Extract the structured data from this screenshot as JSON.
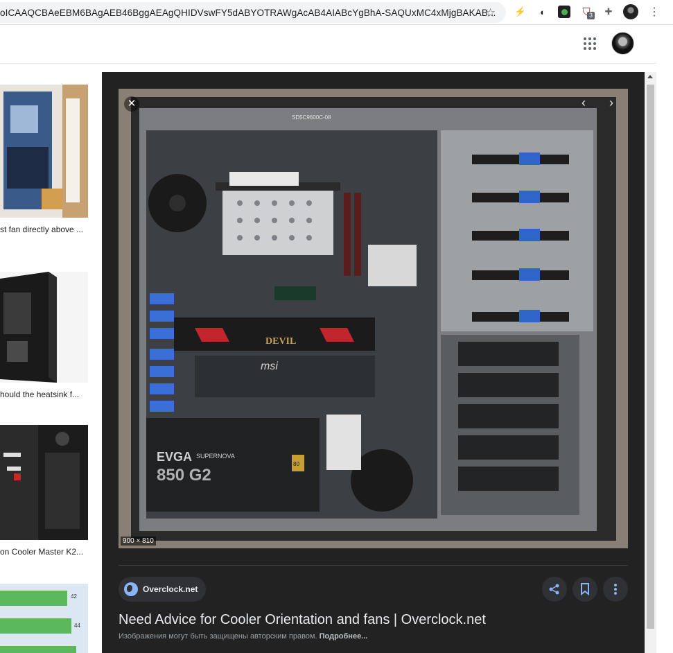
{
  "browser": {
    "url": "oICAAQCBAeEBM6BAgAEB46BggAEAgQHIDVswFY5dABYOTRAWgAcAB4AIABcYgBhA-SAQUxMC4xMjgBAKAB...",
    "extension_badge": "3",
    "icons": [
      "star-icon",
      "bolt-icon",
      "cookie-icon",
      "green-extension-icon",
      "shield-extension-icon",
      "puzzle-icon",
      "profile-avatar",
      "kebab-menu-icon"
    ]
  },
  "header": {
    "icons": [
      "apps-grid-icon",
      "account-avatar"
    ]
  },
  "results": [
    {
      "caption": "st fan directly above ..."
    },
    {
      "caption": "hould the heatsink f..."
    },
    {
      "caption": "on Cooler Master K2..."
    },
    {
      "caption": "",
      "bar_labels": [
        "42",
        "44"
      ]
    }
  ],
  "preview": {
    "dimensions": "900 × 810",
    "source": "Overclock.net",
    "title": "Need Advice for Cooler Orientation and fans | Overclock.net",
    "copyright_text": "Изображения могут быть защищены авторским правом.",
    "copyright_link": "Подробнее...",
    "psu_brand": "EVGA",
    "psu_series": "SUPERNOVA",
    "psu_model": "850 G2",
    "psu_rating": "80",
    "case_label": "SD5C9600C-08",
    "gpu_label": "DEVIL",
    "board_label": "msi"
  },
  "colors": {
    "panel_bg": "#222222",
    "chip_bg": "#303134",
    "accent_blue": "#8ab4f8",
    "title_text": "#e8eaed"
  }
}
